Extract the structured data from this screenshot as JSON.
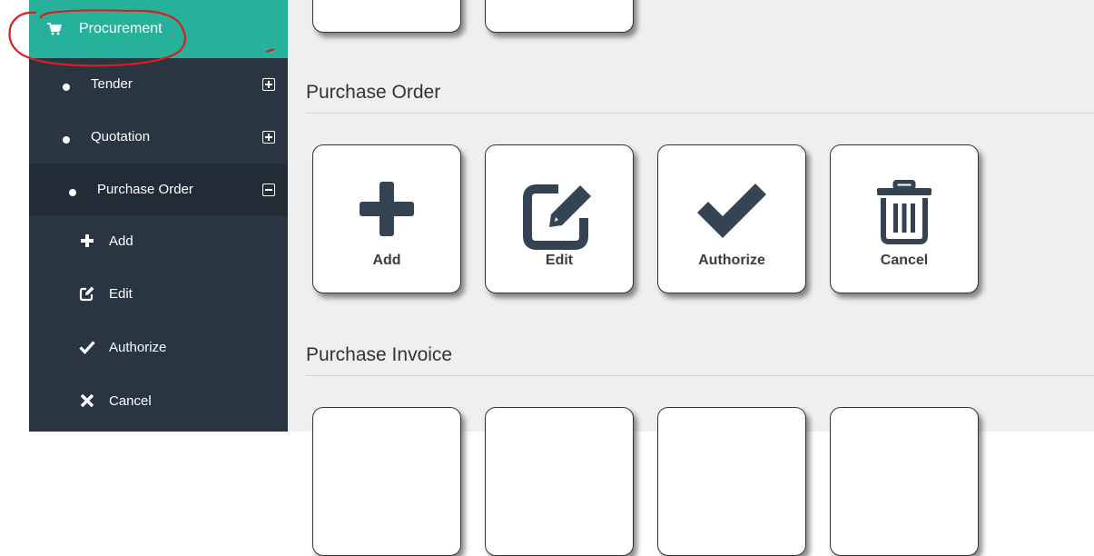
{
  "sidebar": {
    "header": {
      "label": "Procurement",
      "icon": "shopping-cart-icon",
      "bg_color": "#26b29a"
    },
    "items": [
      {
        "label": "Tender",
        "toggle": "expand"
      },
      {
        "label": "Quotation",
        "toggle": "expand"
      },
      {
        "label": "Purchase Order",
        "toggle": "collapse",
        "active": true
      }
    ],
    "sub_items": [
      {
        "label": "Add",
        "icon": "plus-icon"
      },
      {
        "label": "Edit",
        "icon": "edit-icon"
      },
      {
        "label": "Authorize",
        "icon": "check-icon"
      },
      {
        "label": "Cancel",
        "icon": "times-icon"
      }
    ],
    "bg_color": "#2a3542"
  },
  "main": {
    "purchase_order": {
      "title": "Purchase Order",
      "cards": [
        {
          "label": "Add",
          "icon": "plus-icon"
        },
        {
          "label": "Edit",
          "icon": "edit-icon"
        },
        {
          "label": "Authorize",
          "icon": "check-icon"
        },
        {
          "label": "Cancel",
          "icon": "trash-icon"
        }
      ]
    },
    "purchase_invoice": {
      "title": "Purchase Invoice"
    }
  },
  "annotation": {
    "color": "#d42020"
  }
}
